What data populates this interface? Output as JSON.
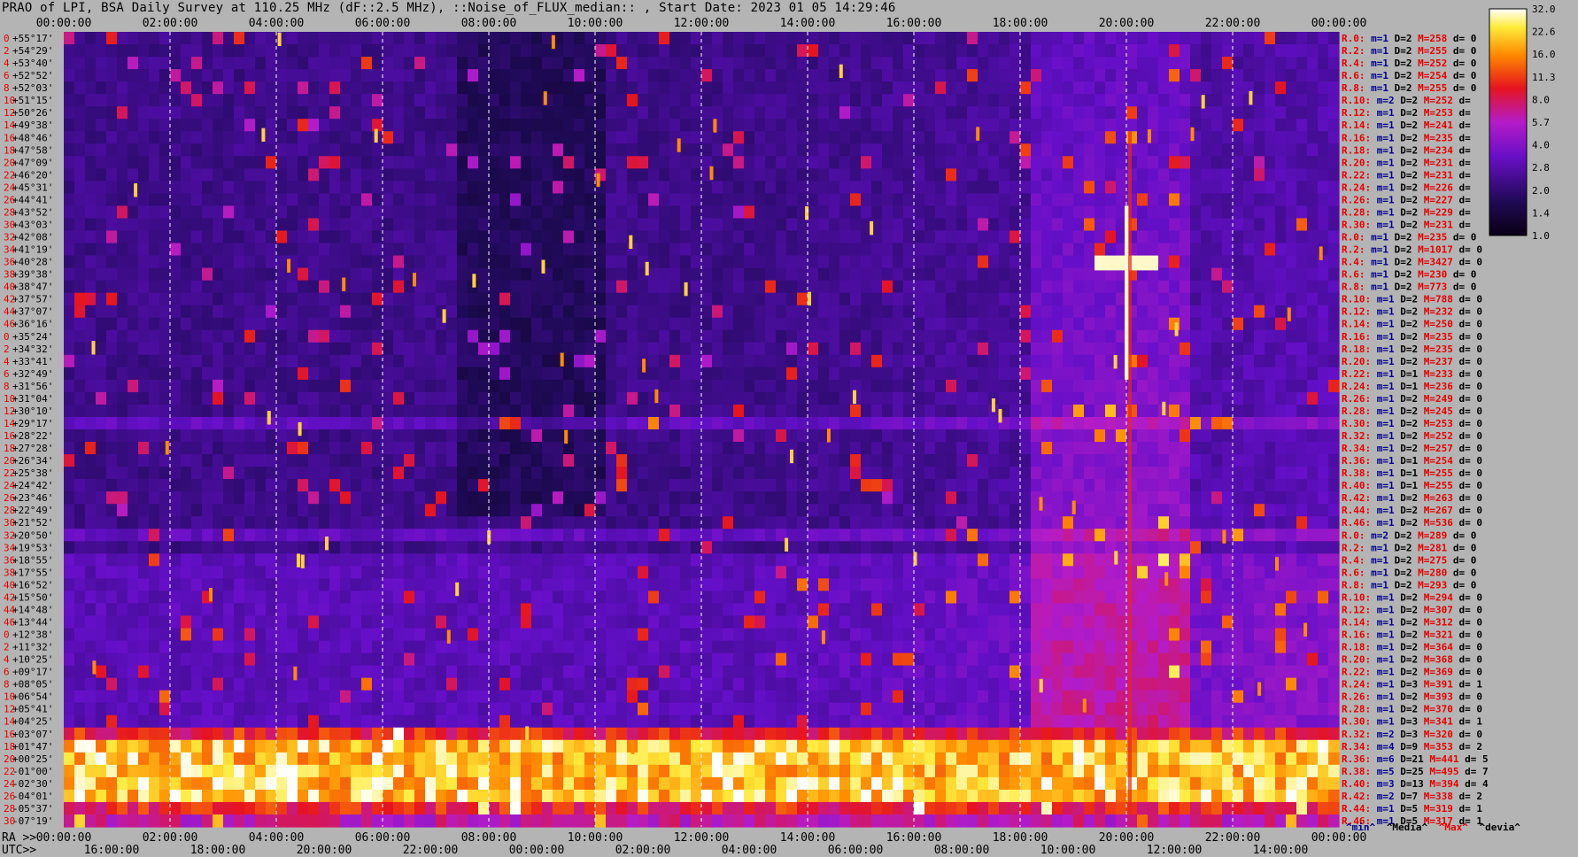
{
  "title": "PRAO of LPI, BSA Daily Survey at 110.25 MHz (dF::2.5 MHz), ::Noise_of_FLUX_median:: , Start Date: 2023 01 05 14:29:46",
  "top_time_ticks": [
    "00:00:00",
    "02:00:00",
    "04:00:00",
    "06:00:00",
    "08:00:00",
    "10:00:00",
    "12:00:00",
    "14:00:00",
    "16:00:00",
    "18:00:00",
    "20:00:00",
    "22:00:00",
    "00:00:00"
  ],
  "bottom_ra_label": "RA >>",
  "bottom_ra_ticks": [
    "00:00:00",
    "02:00:00",
    "04:00:00",
    "06:00:00",
    "08:00:00",
    "10:00:00",
    "12:00:00",
    "14:00:00",
    "16:00:00",
    "18:00:00",
    "20:00:00",
    "22:00:00",
    "00:00:00"
  ],
  "bottom_utc_label": "UTC>>",
  "bottom_utc_ticks": [
    "16:00:00",
    "18:00:00",
    "20:00:00",
    "22:00:00",
    "00:00:00",
    "02:00:00",
    "04:00:00",
    "06:00:00",
    "08:00:00",
    "10:00:00",
    "12:00:00",
    "14:00:00"
  ],
  "dec_labels": [
    "+55°17'",
    "+54°29'",
    "+53°40'",
    "+52°52'",
    "+52°03'",
    "+51°15'",
    "+50°26'",
    "+49°38'",
    "+48°46'",
    "+47°58'",
    "+47°09'",
    "+46°20'",
    "+45°31'",
    "+44°41'",
    "+43°52'",
    "+43°03'",
    "+42°08'",
    "+41°19'",
    "+40°28'",
    "+39°38'",
    "+38°47'",
    "+37°57'",
    "+37°07'",
    "+36°16'",
    "+35°24'",
    "+34°32'",
    "+33°41'",
    "+32°49'",
    "+31°56'",
    "+31°04'",
    "+30°10'",
    "+29°17'",
    "+28°22'",
    "+27°28'",
    "+26°34'",
    "+25°38'",
    "+24°42'",
    "+23°46'",
    "+22°49'",
    "+21°52'",
    "+20°50'",
    "+19°53'",
    "+18°55'",
    "+17°55'",
    "+16°52'",
    "+15°50'",
    "+14°48'",
    "+13°44'",
    "+12°38'",
    "+11°32'",
    "+10°25'",
    "+09°17'",
    "+08°05'",
    "+06°54'",
    "+05°41'",
    "+04°25'",
    "+03°07'",
    "+01°47'",
    "+00°25'",
    "-01°00'",
    "-02°30'",
    "-04°01'",
    "-05°37'",
    "-07°19'"
  ],
  "row_indices": [
    "0",
    "2",
    "4",
    "6",
    "8",
    "10",
    "12",
    "14",
    "16",
    "18",
    "20",
    "22",
    "24",
    "26",
    "28",
    "30",
    "32",
    "34",
    "36",
    "38",
    "40",
    "42",
    "44",
    "46",
    "0",
    "2",
    "4",
    "6",
    "8",
    "10",
    "12",
    "14",
    "16",
    "18",
    "20",
    "22",
    "24",
    "26",
    "28",
    "30",
    "32",
    "34",
    "36",
    "38",
    "40",
    "42",
    "44",
    "46",
    "0",
    "2",
    "4",
    "6",
    "8",
    "10",
    "12",
    "14",
    "16",
    "18",
    "20",
    "22",
    "24",
    "26",
    "28",
    "30"
  ],
  "stats_rows": [
    {
      "r": "R.0:",
      "m": "m=1",
      "D": "D=2",
      "M": "M=258",
      "d": "d= 0"
    },
    {
      "r": "R.2:",
      "m": "m=1",
      "D": "D=2",
      "M": "M=255",
      "d": "d= 0"
    },
    {
      "r": "R.4:",
      "m": "m=1",
      "D": "D=2",
      "M": "M=252",
      "d": "d= 0"
    },
    {
      "r": "R.6:",
      "m": "m=1",
      "D": "D=2",
      "M": "M=254",
      "d": "d= 0"
    },
    {
      "r": "R.8:",
      "m": "m=1",
      "D": "D=2",
      "M": "M=255",
      "d": "d= 0"
    },
    {
      "r": "R.10:",
      "m": "m=2",
      "D": "D=2",
      "M": "M=252",
      "d": "d="
    },
    {
      "r": "R.12:",
      "m": "m=1",
      "D": "D=2",
      "M": "M=253",
      "d": "d="
    },
    {
      "r": "R.14:",
      "m": "m=1",
      "D": "D=2",
      "M": "M=241",
      "d": "d="
    },
    {
      "r": "R.16:",
      "m": "m=1",
      "D": "D=2",
      "M": "M=235",
      "d": "d="
    },
    {
      "r": "R.18:",
      "m": "m=1",
      "D": "D=2",
      "M": "M=234",
      "d": "d="
    },
    {
      "r": "R.20:",
      "m": "m=1",
      "D": "D=2",
      "M": "M=231",
      "d": "d="
    },
    {
      "r": "R.22:",
      "m": "m=1",
      "D": "D=2",
      "M": "M=231",
      "d": "d="
    },
    {
      "r": "R.24:",
      "m": "m=1",
      "D": "D=2",
      "M": "M=226",
      "d": "d="
    },
    {
      "r": "R.26:",
      "m": "m=1",
      "D": "D=2",
      "M": "M=227",
      "d": "d="
    },
    {
      "r": "R.28:",
      "m": "m=1",
      "D": "D=2",
      "M": "M=229",
      "d": "d="
    },
    {
      "r": "R.30:",
      "m": "m=1",
      "D": "D=2",
      "M": "M=231",
      "d": "d="
    },
    {
      "r": "R.0:",
      "m": "m=1",
      "D": "D=2",
      "M": "M=235",
      "d": "d= 0"
    },
    {
      "r": "R.2:",
      "m": "m=1",
      "D": "D=2",
      "M": "M=1017",
      "d": "d= 0"
    },
    {
      "r": "R.4:",
      "m": "m=1",
      "D": "D=2",
      "M": "M=3427",
      "d": "d= 0"
    },
    {
      "r": "R.6:",
      "m": "m=1",
      "D": "D=2",
      "M": "M=230",
      "d": "d= 0"
    },
    {
      "r": "R.8:",
      "m": "m=1",
      "D": "D=2",
      "M": "M=773",
      "d": "d= 0"
    },
    {
      "r": "R.10:",
      "m": "m=1",
      "D": "D=2",
      "M": "M=788",
      "d": "d= 0"
    },
    {
      "r": "R.12:",
      "m": "m=1",
      "D": "D=2",
      "M": "M=232",
      "d": "d= 0"
    },
    {
      "r": "R.14:",
      "m": "m=1",
      "D": "D=2",
      "M": "M=250",
      "d": "d= 0"
    },
    {
      "r": "R.16:",
      "m": "m=1",
      "D": "D=2",
      "M": "M=235",
      "d": "d= 0"
    },
    {
      "r": "R.18:",
      "m": "m=1",
      "D": "D=2",
      "M": "M=235",
      "d": "d= 0"
    },
    {
      "r": "R.20:",
      "m": "m=1",
      "D": "D=2",
      "M": "M=237",
      "d": "d= 0"
    },
    {
      "r": "R.22:",
      "m": "m=1",
      "D": "D=1",
      "M": "M=233",
      "d": "d= 0"
    },
    {
      "r": "R.24:",
      "m": "m=1",
      "D": "D=1",
      "M": "M=236",
      "d": "d= 0"
    },
    {
      "r": "R.26:",
      "m": "m=1",
      "D": "D=2",
      "M": "M=249",
      "d": "d= 0"
    },
    {
      "r": "R.28:",
      "m": "m=1",
      "D": "D=2",
      "M": "M=245",
      "d": "d= 0"
    },
    {
      "r": "R.30:",
      "m": "m=1",
      "D": "D=2",
      "M": "M=253",
      "d": "d= 0"
    },
    {
      "r": "R.32:",
      "m": "m=1",
      "D": "D=2",
      "M": "M=252",
      "d": "d= 0"
    },
    {
      "r": "R.34:",
      "m": "m=1",
      "D": "D=2",
      "M": "M=257",
      "d": "d= 0"
    },
    {
      "r": "R.36:",
      "m": "m=1",
      "D": "D=1",
      "M": "M=254",
      "d": "d= 0"
    },
    {
      "r": "R.38:",
      "m": "m=1",
      "D": "D=1",
      "M": "M=255",
      "d": "d= 0"
    },
    {
      "r": "R.40:",
      "m": "m=1",
      "D": "D=1",
      "M": "M=255",
      "d": "d= 0"
    },
    {
      "r": "R.42:",
      "m": "m=1",
      "D": "D=2",
      "M": "M=263",
      "d": "d= 0"
    },
    {
      "r": "R.44:",
      "m": "m=1",
      "D": "D=2",
      "M": "M=267",
      "d": "d= 0"
    },
    {
      "r": "R.46:",
      "m": "m=1",
      "D": "D=2",
      "M": "M=536",
      "d": "d= 0"
    },
    {
      "r": "R.0:",
      "m": "m=2",
      "D": "D=2",
      "M": "M=289",
      "d": "d= 0"
    },
    {
      "r": "R.2:",
      "m": "m=1",
      "D": "D=2",
      "M": "M=281",
      "d": "d= 0"
    },
    {
      "r": "R.4:",
      "m": "m=1",
      "D": "D=2",
      "M": "M=275",
      "d": "d= 0"
    },
    {
      "r": "R.6:",
      "m": "m=1",
      "D": "D=2",
      "M": "M=280",
      "d": "d= 0"
    },
    {
      "r": "R.8:",
      "m": "m=1",
      "D": "D=2",
      "M": "M=293",
      "d": "d= 0"
    },
    {
      "r": "R.10:",
      "m": "m=1",
      "D": "D=2",
      "M": "M=294",
      "d": "d= 0"
    },
    {
      "r": "R.12:",
      "m": "m=1",
      "D": "D=2",
      "M": "M=307",
      "d": "d= 0"
    },
    {
      "r": "R.14:",
      "m": "m=1",
      "D": "D=2",
      "M": "M=312",
      "d": "d= 0"
    },
    {
      "r": "R.16:",
      "m": "m=1",
      "D": "D=2",
      "M": "M=321",
      "d": "d= 0"
    },
    {
      "r": "R.18:",
      "m": "m=1",
      "D": "D=2",
      "M": "M=364",
      "d": "d= 0"
    },
    {
      "r": "R.20:",
      "m": "m=1",
      "D": "D=2",
      "M": "M=368",
      "d": "d= 0"
    },
    {
      "r": "R.22:",
      "m": "m=1",
      "D": "D=2",
      "M": "M=369",
      "d": "d= 0"
    },
    {
      "r": "R.24:",
      "m": "m=1",
      "D": "D=3",
      "M": "M=391",
      "d": "d= 1"
    },
    {
      "r": "R.26:",
      "m": "m=1",
      "D": "D=2",
      "M": "M=393",
      "d": "d= 0"
    },
    {
      "r": "R.28:",
      "m": "m=1",
      "D": "D=2",
      "M": "M=370",
      "d": "d= 0"
    },
    {
      "r": "R.30:",
      "m": "m=1",
      "D": "D=3",
      "M": "M=341",
      "d": "d= 1"
    },
    {
      "r": "R.32:",
      "m": "m=2",
      "D": "D=3",
      "M": "M=320",
      "d": "d= 0"
    },
    {
      "r": "R.34:",
      "m": "m=4",
      "D": "D=9",
      "M": "M=353",
      "d": "d= 2"
    },
    {
      "r": "R.36:",
      "m": "m=6",
      "D": "D=21",
      "M": "M=441",
      "d": "d= 5"
    },
    {
      "r": "R.38:",
      "m": "m=5",
      "D": "D=25",
      "M": "M=495",
      "d": "d= 7"
    },
    {
      "r": "R.40:",
      "m": "m=3",
      "D": "D=13",
      "M": "M=394",
      "d": "d= 4"
    },
    {
      "r": "R.42:",
      "m": "m=2",
      "D": "D=7",
      "M": "M=338",
      "d": "d= 2"
    },
    {
      "r": "R.44:",
      "m": "m=1",
      "D": "D=5",
      "M": "M=319",
      "d": "d= 1"
    },
    {
      "r": "R.46:",
      "m": "m=1",
      "D": "D=5",
      "M": "M=317",
      "d": "d= 1"
    }
  ],
  "legend": {
    "min": "^min^",
    "median": "^Media^",
    "max": "^Max^",
    "devia": "^devia^"
  },
  "colorbar_ticks": [
    "32.0",
    "22.6",
    "16.0",
    "11.3",
    "8.0",
    "5.7",
    "4.0",
    "2.8",
    "2.0",
    "1.4",
    "1.0"
  ],
  "colors": {
    "background": "#b4b4b4",
    "stat_red": "#e60000",
    "stat_blue": "#00008c",
    "grid_white": "#ffffff"
  },
  "chart_data": {
    "type": "heatmap",
    "title": "PRAO of LPI, BSA Daily Survey at 110.25 MHz (dF::2.5 MHz), ::Noise_of_FLUX_median:: , Start Date: 2023 01 05 14:29:46",
    "x_axis_top": "time 00:00:00 – 00:00:00 (2 h ticks)",
    "x_axis_bottom": [
      "RA >>",
      "UTC>>"
    ],
    "y_axis": "Declination +55°17' to -07°19' (64 beams)",
    "colorscale": "black-purple-red-yellow-white",
    "colorbar_range": [
      1.0,
      32.0
    ],
    "colorbar_scale": "log2",
    "features": [
      {
        "label": "bright equatorial band",
        "dec_range": [
          "+01°47'",
          "-04°01'"
        ],
        "level": "saturated"
      },
      {
        "label": "strong source",
        "ra": "20:00:00",
        "dec": "+40°28'"
      }
    ]
  }
}
